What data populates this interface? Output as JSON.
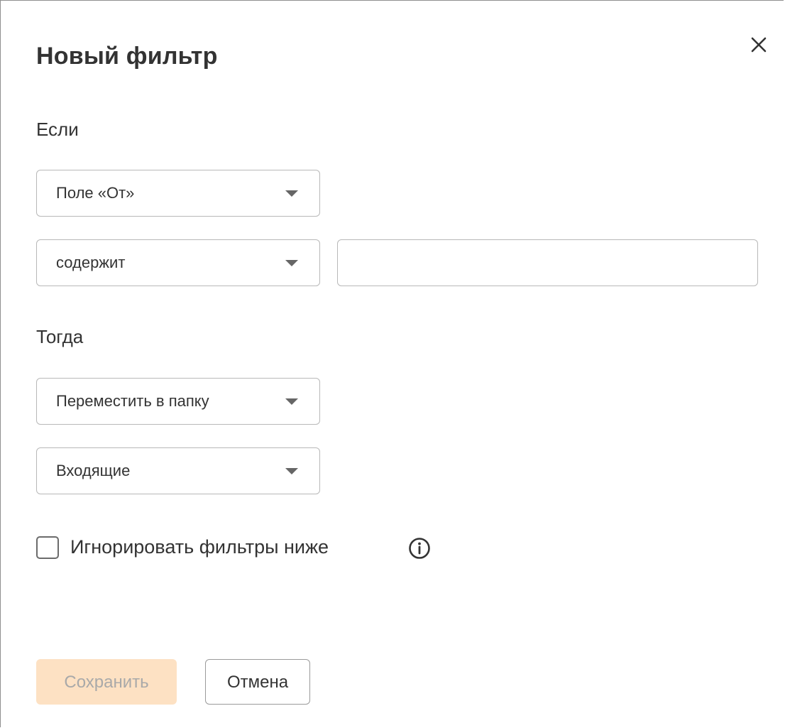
{
  "dialog": {
    "title": "Новый фильтр",
    "close_icon": "close-icon"
  },
  "if_section": {
    "label": "Если",
    "field_select": {
      "value": "Поле «От»"
    },
    "condition_select": {
      "value": "содержит"
    },
    "value_input": {
      "value": "",
      "placeholder": ""
    }
  },
  "then_section": {
    "label": "Тогда",
    "action_select": {
      "value": "Переместить в папку"
    },
    "folder_select": {
      "value": "Входящие"
    }
  },
  "ignore_option": {
    "label": "Игнорировать фильтры ниже",
    "checked": false,
    "info_icon": "info-icon"
  },
  "footer": {
    "save_label": "Сохранить",
    "save_disabled": true,
    "cancel_label": "Отмена"
  },
  "colors": {
    "save_button_bg": "#fde1c3",
    "save_button_text": "#a9a9a9",
    "text": "#333333",
    "border": "#b8b8b8"
  }
}
